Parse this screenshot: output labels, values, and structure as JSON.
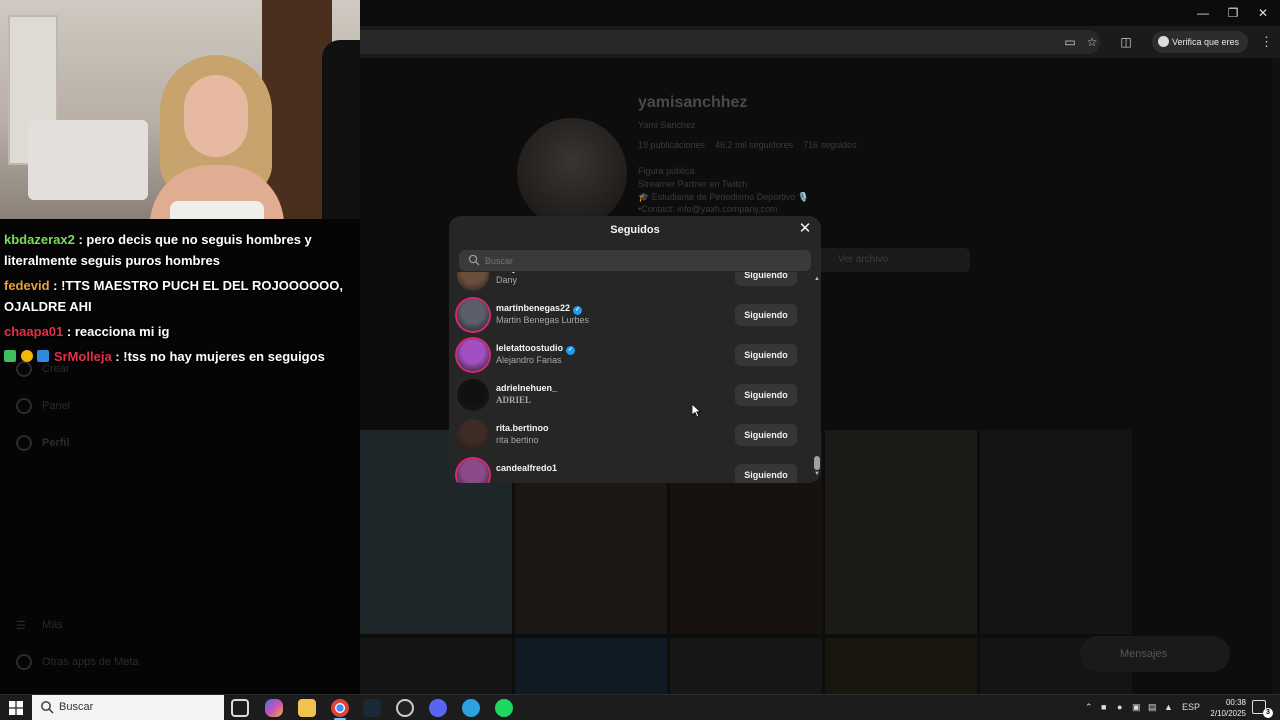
{
  "browser": {
    "verify_chip": "Verifica que eres tú"
  },
  "instagram": {
    "username": "yamisanchhez",
    "fullname": "Yami Sanchez",
    "posts": "19 publicaciones",
    "followers": "46,2 mil seguidores",
    "following": "716 seguidos",
    "category": "Figura pública",
    "bio_line1": "Streamer Partner en Twitch",
    "bio_line2": "🎓 Estudiante de Periodismo Deportivo 🎙️",
    "bio_line3": "•Contact: info@yaxh.company.com",
    "archive_button": "Ver archivo",
    "messages_pill": "Mensajes",
    "sidebar_create": "Crear",
    "sidebar_panel": "Panel",
    "sidebar_profile": "Perfil",
    "sidebar_more": "Más",
    "sidebar_meta": "Otras apps de Meta"
  },
  "modal": {
    "title": "Seguidos",
    "search_placeholder": "Buscar",
    "rows": [
      {
        "username": "danycabreera",
        "fullname": "Dany",
        "button": "Siguiendo",
        "verified": false,
        "avatar_color": "#6b4f3d"
      },
      {
        "username": "martinbenegas22",
        "fullname": "Martin Benegas Lurbes",
        "button": "Siguiendo",
        "verified": true,
        "avatar_color": "#5a5f6a"
      },
      {
        "username": "leletattoostudio",
        "fullname": "Alejandro Farias",
        "button": "Siguiendo",
        "verified": true,
        "avatar_color": "#a14fc2"
      },
      {
        "username": "adrielnehuen_",
        "fullname": "ADRIEL",
        "button": "Siguiendo",
        "verified": false,
        "avatar_color": "#111111"
      },
      {
        "username": "rita.bertinoo",
        "fullname": "rita bertino",
        "button": "Siguiendo",
        "verified": false,
        "avatar_color": "#3d2b24"
      },
      {
        "username": "candealfredo1",
        "fullname": "",
        "button": "Siguiendo",
        "verified": false,
        "avatar_color": "#8b4a8a"
      }
    ]
  },
  "chat": [
    {
      "user": "kbdazerax2",
      "color": "#7ddc5a",
      "text": ": pero decis que no seguis hombres y literalmente seguis puros hombres"
    },
    {
      "user": "fedevid",
      "color": "#e8a23b",
      "text": ": !TTS MAESTRO PUCH EL DEL ROJOOOOOO, OJALDRE AHI"
    },
    {
      "user": "chaapa01",
      "color": "#e0304a",
      "text": ": reacciona mi ig"
    },
    {
      "user": "SrMolleja",
      "color": "#e0304a",
      "text": ": !tss no hay mujeres en seguigos"
    }
  ],
  "taskbar": {
    "search_label": "Buscar",
    "lang": "ESP",
    "time": "00:38",
    "date": "2/10/2025",
    "notifications": "3"
  }
}
